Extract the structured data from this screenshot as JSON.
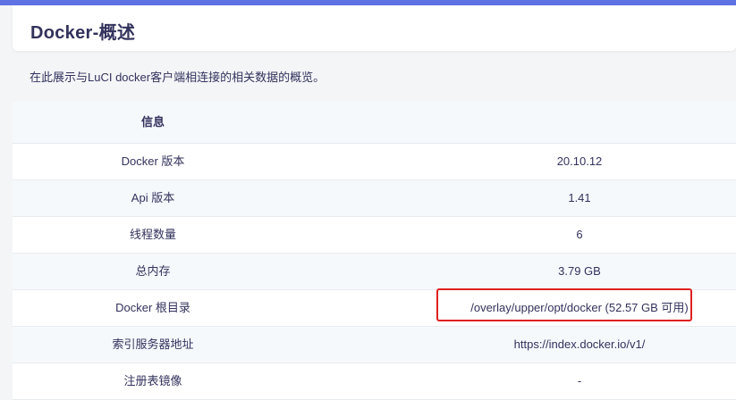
{
  "header": {
    "title": "Docker-概述"
  },
  "description": "在此展示与LuCI docker客户端相连接的相关数据的概览。",
  "table": {
    "header": "信息",
    "rows": [
      {
        "key": "Docker 版本",
        "value": "20.10.12"
      },
      {
        "key": "Api 版本",
        "value": "1.41"
      },
      {
        "key": "线程数量",
        "value": "6"
      },
      {
        "key": "总内存",
        "value": "3.79 GB"
      },
      {
        "key": "Docker 根目录",
        "value": "/overlay/upper/opt/docker (52.57 GB 可用)"
      },
      {
        "key": "索引服务器地址",
        "value": "https://index.docker.io/v1/"
      },
      {
        "key": "注册表镜像",
        "value": "-"
      }
    ]
  },
  "annotation": {
    "highlight_color": "#e02020"
  }
}
